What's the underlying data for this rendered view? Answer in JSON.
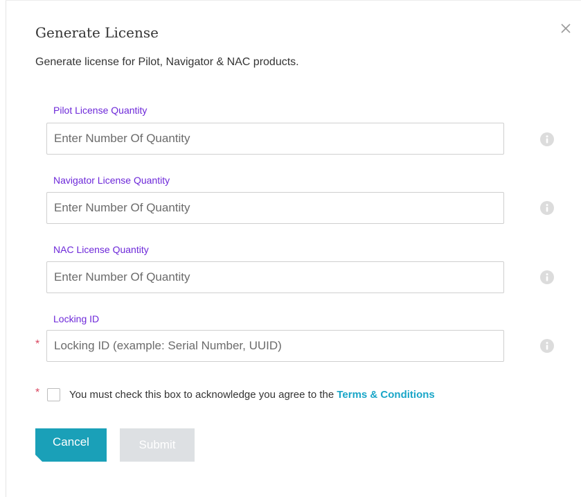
{
  "dialog": {
    "title": "Generate License",
    "subtitle": "Generate license for Pilot, Navigator & NAC products.",
    "close_icon": "close-icon"
  },
  "fields": [
    {
      "label": "Pilot License Quantity",
      "placeholder": "Enter Number Of Quantity",
      "value": "",
      "required": false,
      "info_icon": "info-icon"
    },
    {
      "label": "Navigator License Quantity",
      "placeholder": "Enter Number Of Quantity",
      "value": "",
      "required": false,
      "info_icon": "info-icon"
    },
    {
      "label": "NAC License Quantity",
      "placeholder": "Enter Number Of Quantity",
      "value": "",
      "required": false,
      "info_icon": "info-icon"
    },
    {
      "label": "Locking ID",
      "placeholder": "Locking ID (example: Serial Number, UUID)",
      "value": "",
      "required": true,
      "info_icon": "info-icon"
    }
  ],
  "required_marker": "*",
  "agreement": {
    "checked": false,
    "text": "You must check this box to acknowledge you agree to the ",
    "link_text": "Terms & Conditions"
  },
  "buttons": {
    "cancel_label": "Cancel",
    "submit_label": "Submit",
    "submit_enabled": false
  },
  "colors": {
    "label": "#6d28d9",
    "accent": "#1aa0b8",
    "link": "#1aa6c8",
    "required": "#d9455f",
    "disabled_button": "#dde0e3"
  }
}
